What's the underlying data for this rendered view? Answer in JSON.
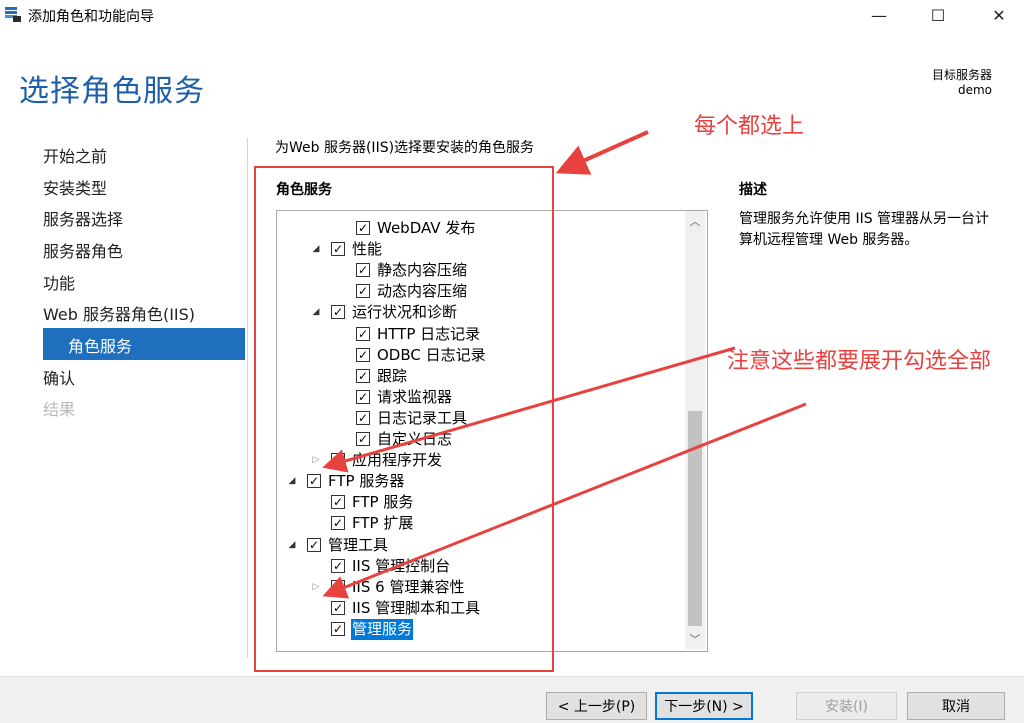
{
  "window": {
    "title": "添加角色和功能向导",
    "minimize_glyph": "—",
    "maximize_glyph": "☐",
    "close_glyph": "✕"
  },
  "header": {
    "page_title": "选择角色服务",
    "target_label": "目标服务器",
    "target_name": "demo"
  },
  "nav": [
    {
      "label": "开始之前",
      "state": "normal"
    },
    {
      "label": "安装类型",
      "state": "normal"
    },
    {
      "label": "服务器选择",
      "state": "normal"
    },
    {
      "label": "服务器角色",
      "state": "normal"
    },
    {
      "label": "功能",
      "state": "normal"
    },
    {
      "label": "Web 服务器角色(IIS)",
      "state": "normal"
    },
    {
      "label": "角色服务",
      "state": "selected"
    },
    {
      "label": "确认",
      "state": "normal"
    },
    {
      "label": "结果",
      "state": "disabled"
    }
  ],
  "content": {
    "instruction": "为Web 服务器(IIS)选择要安装的角色服务",
    "roles_heading": "角色服务",
    "description_heading": "描述",
    "description_text": "管理服务允许使用 IIS 管理器从另一台计算机远程管理 Web 服务器。"
  },
  "tree": [
    {
      "label": "WebDAV 发布",
      "level": 3,
      "expander": "none",
      "checked": true
    },
    {
      "label": "性能",
      "level": 2,
      "expander": "open",
      "checked": true
    },
    {
      "label": "静态内容压缩",
      "level": 3,
      "expander": "none",
      "checked": true
    },
    {
      "label": "动态内容压缩",
      "level": 3,
      "expander": "none",
      "checked": true
    },
    {
      "label": "运行状况和诊断",
      "level": 2,
      "expander": "open",
      "checked": true
    },
    {
      "label": "HTTP 日志记录",
      "level": 3,
      "expander": "none",
      "checked": true
    },
    {
      "label": "ODBC 日志记录",
      "level": 3,
      "expander": "none",
      "checked": true
    },
    {
      "label": "跟踪",
      "level": 3,
      "expander": "none",
      "checked": true
    },
    {
      "label": "请求监视器",
      "level": 3,
      "expander": "none",
      "checked": true
    },
    {
      "label": "日志记录工具",
      "level": 3,
      "expander": "none",
      "checked": true
    },
    {
      "label": "自定义日志",
      "level": 3,
      "expander": "none",
      "checked": true
    },
    {
      "label": "应用程序开发",
      "level": 2,
      "expander": "closed",
      "checked": true
    },
    {
      "label": "FTP 服务器",
      "level": 1,
      "expander": "open",
      "checked": true
    },
    {
      "label": "FTP 服务",
      "level": 2,
      "expander": "none",
      "checked": true
    },
    {
      "label": "FTP 扩展",
      "level": 2,
      "expander": "none",
      "checked": true
    },
    {
      "label": "管理工具",
      "level": 1,
      "expander": "open",
      "checked": true
    },
    {
      "label": "IIS 管理控制台",
      "level": 2,
      "expander": "none",
      "checked": true
    },
    {
      "label": "IIS 6 管理兼容性",
      "level": 2,
      "expander": "closed",
      "checked": true
    },
    {
      "label": "IIS 管理脚本和工具",
      "level": 2,
      "expander": "none",
      "checked": true
    },
    {
      "label": "管理服务",
      "level": 2,
      "expander": "none",
      "checked": true,
      "selected": true
    }
  ],
  "glyphs": {
    "check": "✓",
    "expander_open": "◢",
    "expander_closed": "▷",
    "scroll_up": "︿",
    "scroll_down": "﹀"
  },
  "annotations": {
    "note_1": "每个都选上",
    "note_2": "注意这些都要展开勾选全部",
    "color": "#e8423f"
  },
  "footer": {
    "prev": "< 上一步(P)",
    "next": "下一步(N) >",
    "install": "安装(I)",
    "cancel": "取消"
  }
}
